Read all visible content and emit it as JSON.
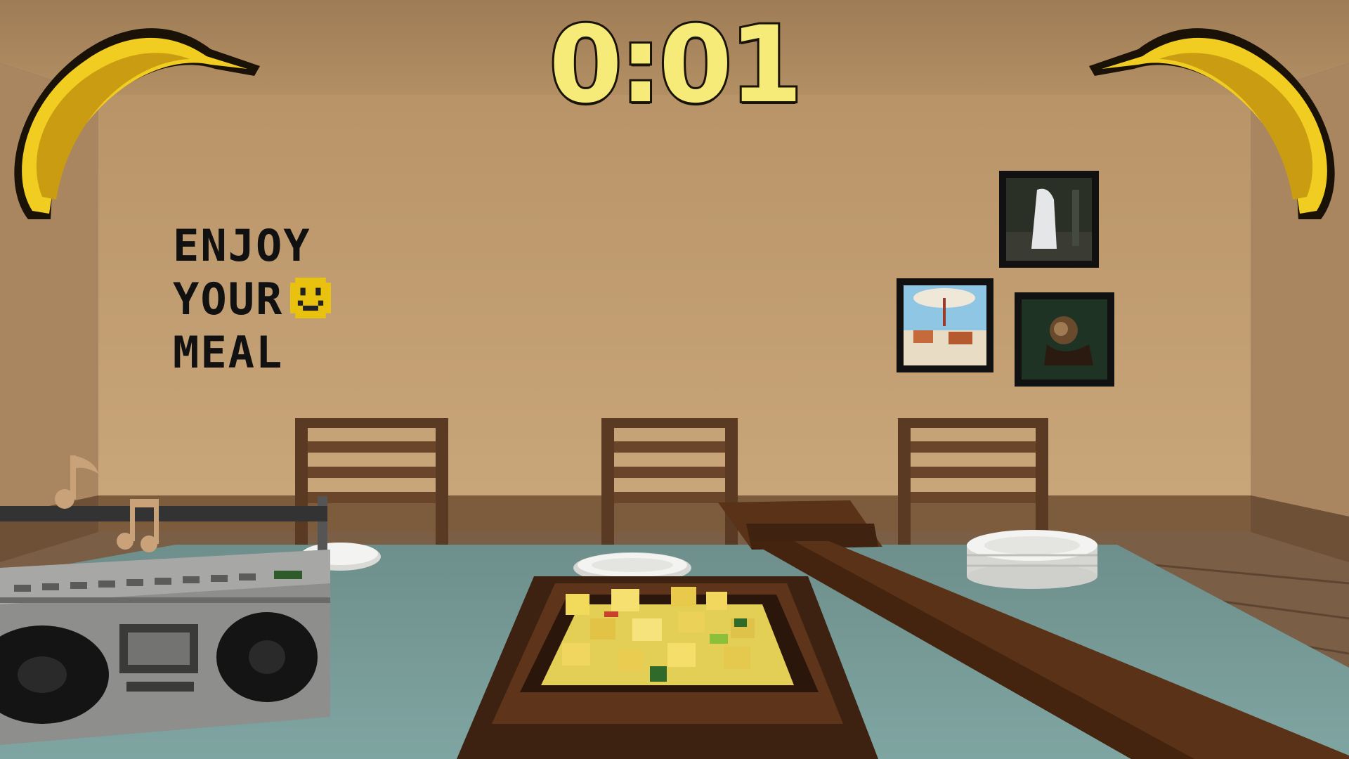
{
  "hud": {
    "timer": "0:01",
    "left_icon": "banana-icon",
    "right_icon": "banana-icon"
  },
  "wall_sign": {
    "line1": "ENJOY",
    "line2": "YOUR",
    "line3": "MEAL",
    "emoji": "smiley-face-icon"
  },
  "colors": {
    "wall": "#c09c70",
    "ceiling": "#b59369",
    "tablecloth": "#769b98",
    "wood": "#4e2a15",
    "timer_fill": "#f6ea78",
    "banana": "#f0c81e"
  }
}
